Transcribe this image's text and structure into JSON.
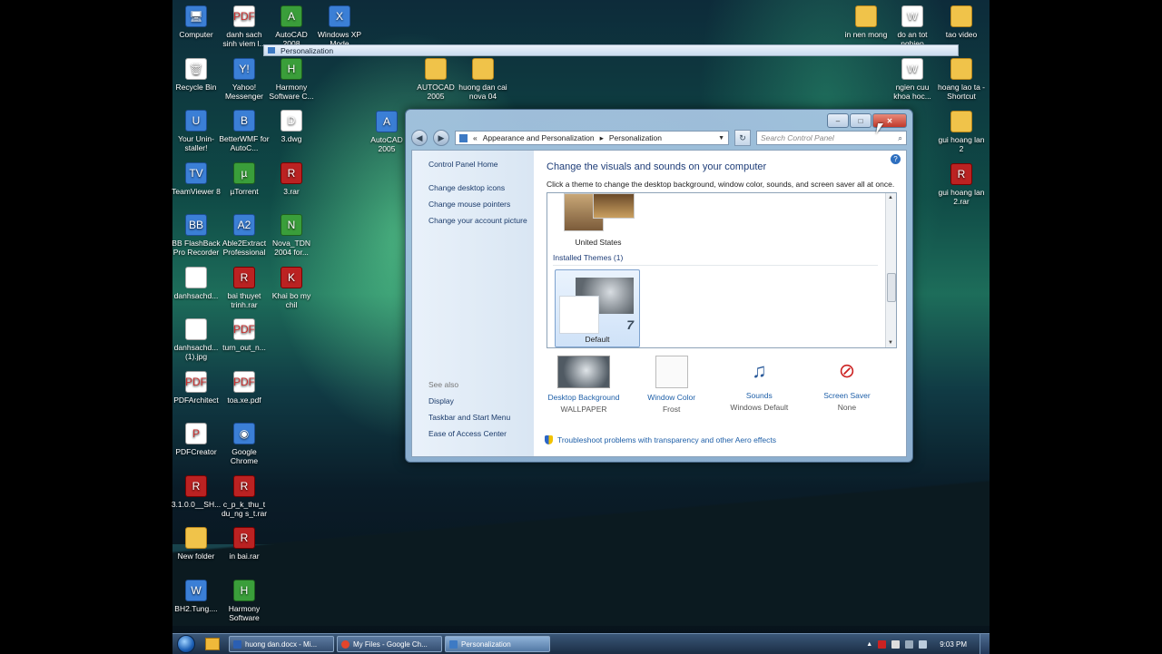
{
  "desktop": {
    "icons_left": [
      {
        "label": "Computer",
        "glyph": "🖥",
        "kind": "app"
      },
      {
        "label": "danh sach sinh viem l...",
        "glyph": "PDF",
        "kind": "doc"
      },
      {
        "label": "AutoCAD 2008",
        "glyph": "A",
        "kind": "green"
      },
      {
        "label": "Windows XP Mode",
        "glyph": "X",
        "kind": "app"
      },
      {
        "label": "Recycle Bin",
        "glyph": "🗑",
        "kind": "white"
      },
      {
        "label": "Yahoo! Messenger",
        "glyph": "Y!",
        "kind": "app"
      },
      {
        "label": "Harmony Software C...",
        "glyph": "H",
        "kind": "green"
      },
      {
        "label": "Your Unin-staller!",
        "glyph": "U",
        "kind": "app"
      },
      {
        "label": "BetterWMF for AutoC...",
        "glyph": "B",
        "kind": "app"
      },
      {
        "label": "3.dwg",
        "glyph": "D",
        "kind": "white"
      },
      {
        "label": "TeamViewer 8",
        "glyph": "TV",
        "kind": "app"
      },
      {
        "label": "µTorrent",
        "glyph": "µ",
        "kind": "green"
      },
      {
        "label": "3.rar",
        "glyph": "R",
        "kind": "rar"
      },
      {
        "label": "BB FlashBack Pro Recorder",
        "glyph": "BB",
        "kind": "app"
      },
      {
        "label": "Able2Extract Professional",
        "glyph": "A2",
        "kind": "app"
      },
      {
        "label": "Nova_TDN 2004 for...",
        "glyph": "N",
        "kind": "green"
      },
      {
        "label": "danhsachd...",
        "glyph": "",
        "kind": "white"
      },
      {
        "label": "bai thuyet trinh.rar",
        "glyph": "R",
        "kind": "rar"
      },
      {
        "label": "Khai bo my chil",
        "glyph": "K",
        "kind": "rar"
      },
      {
        "label": "danhsachd... (1).jpg",
        "glyph": "",
        "kind": "white"
      },
      {
        "label": "turn_out_n...",
        "glyph": "PDF",
        "kind": "doc"
      },
      {
        "label": "PDFArchitect",
        "glyph": "PDF",
        "kind": "doc"
      },
      {
        "label": "toa.xe.pdf",
        "glyph": "PDF",
        "kind": "doc"
      },
      {
        "label": "PDFCreator",
        "glyph": "P",
        "kind": "doc"
      },
      {
        "label": "Google Chrome",
        "glyph": "◉",
        "kind": "app"
      },
      {
        "label": "3.1.0.0__SH...",
        "glyph": "R",
        "kind": "rar"
      },
      {
        "label": "c_p_k_thu_t du_ng s_t.rar",
        "glyph": "R",
        "kind": "rar"
      },
      {
        "label": "New folder",
        "glyph": "",
        "kind": "folder"
      },
      {
        "label": "in bai.rar",
        "glyph": "R",
        "kind": "rar"
      },
      {
        "label": "BH2.Tung....",
        "glyph": "W",
        "kind": "app"
      },
      {
        "label": "Harmony Software",
        "glyph": "H",
        "kind": "green"
      }
    ],
    "icons_mid": [
      {
        "label": "AUTOCAD 2005",
        "glyph": "",
        "kind": "folder"
      },
      {
        "label": "huong dan cai nova 04",
        "glyph": "",
        "kind": "folder"
      },
      {
        "label": "AutoCAD 2005",
        "glyph": "A",
        "kind": "app"
      }
    ],
    "icons_right": [
      {
        "label": "in nen mong",
        "glyph": "",
        "kind": "folder"
      },
      {
        "label": "do an tot nghiep",
        "glyph": "W",
        "kind": "white"
      },
      {
        "label": "tao video",
        "glyph": "",
        "kind": "folder"
      },
      {
        "label": "ngien cuu khoa hoc...",
        "glyph": "W",
        "kind": "white"
      },
      {
        "label": "hoang lao ta - Shortcut",
        "glyph": "",
        "kind": "folder"
      },
      {
        "label": "gui hoang lan 2",
        "glyph": "",
        "kind": "folder"
      },
      {
        "label": "gui hoang lan 2.rar",
        "glyph": "R",
        "kind": "rar"
      }
    ]
  },
  "mini_title": "Personalization",
  "window": {
    "breadcrumb_root": "«",
    "breadcrumb_1": "Appearance and Personalization",
    "breadcrumb_sep": "▸",
    "breadcrumb_2": "Personalization",
    "search_placeholder": "Search Control Panel",
    "left": {
      "home": "Control Panel Home",
      "links": [
        "Change desktop icons",
        "Change mouse pointers",
        "Change your account picture"
      ],
      "see_also": "See also",
      "see_also_links": [
        "Display",
        "Taskbar and Start Menu",
        "Ease of Access Center"
      ]
    },
    "heading": "Change the visuals and sounds on your computer",
    "subheading": "Click a theme to change the desktop background, window color, sounds, and screen saver all at once.",
    "theme_us": "United States",
    "installed_header": "Installed Themes (1)",
    "theme_default": "Default",
    "bottom": [
      {
        "name": "Desktop Background",
        "value": "WALLPAPER"
      },
      {
        "name": "Window Color",
        "value": "Frost"
      },
      {
        "name": "Sounds",
        "value": "Windows Default"
      },
      {
        "name": "Screen Saver",
        "value": "None"
      }
    ],
    "troubleshoot": "Troubleshoot problems with transparency and other Aero effects"
  },
  "taskbar": {
    "tasks": [
      {
        "label": "huong dan.docx - Mi...",
        "color": "#2b5fb3"
      },
      {
        "label": "My Files - Google Ch...",
        "color": "#e4452b"
      },
      {
        "label": "Personalization",
        "color": "#3d7ac4"
      }
    ],
    "clock": "9:03 PM"
  }
}
